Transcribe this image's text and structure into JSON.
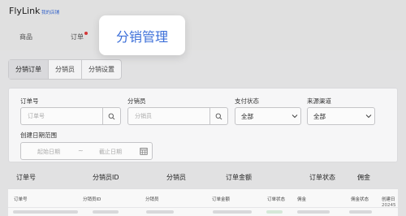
{
  "app": {
    "brand": "FlyLink",
    "store_link": "我的店铺"
  },
  "nav": {
    "items": [
      "商品",
      "订单"
    ]
  },
  "popover": {
    "label": "分销管理"
  },
  "tabs": [
    "分销订单",
    "分销员",
    "分销设置"
  ],
  "filters": {
    "order_no": {
      "label": "订单号",
      "placeholder": "订单号"
    },
    "distributor": {
      "label": "分销员",
      "placeholder": "分销员"
    },
    "pay_status": {
      "label": "支付状态",
      "value": "全部"
    },
    "source": {
      "label": "来源渠道",
      "value": "全部"
    },
    "date_range": {
      "label": "创建日期范围",
      "start_placeholder": "起始日期",
      "separator": "~",
      "end_placeholder": "截止日期"
    }
  },
  "table_header_top": [
    "订单号",
    "分销员ID",
    "分销员",
    "订单金额",
    "订单状态",
    "佣金"
  ],
  "table_header_grid": [
    "订单号",
    "分销员ID",
    "分销员",
    "订单金额",
    "订单状态",
    "佣金",
    "佣金状态",
    "创建日"
  ],
  "table_rows": [
    {
      "created": "20245"
    }
  ],
  "colors": {
    "accent": "#3c6fd9",
    "brand_link": "#3b6cd6",
    "nav_dot": "#e23b3b"
  }
}
